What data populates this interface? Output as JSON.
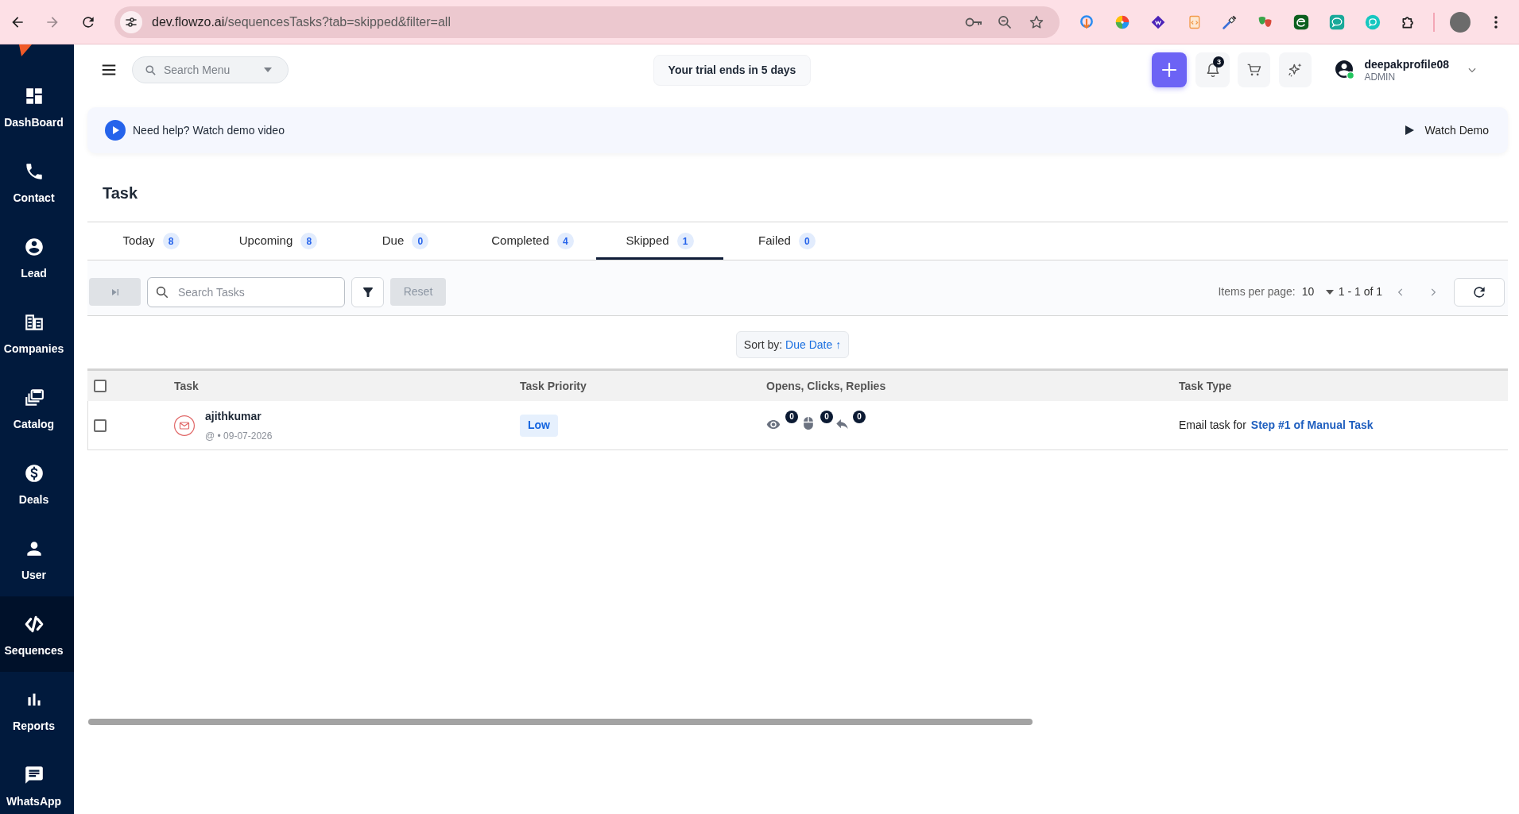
{
  "browser": {
    "url": {
      "host": "dev.flowzo.ai",
      "path": "/sequencesTasks?tab=skipped&filter=all"
    }
  },
  "sidebar": {
    "items": [
      {
        "label": "DashBoard",
        "selected": false
      },
      {
        "label": "Contact",
        "selected": false
      },
      {
        "label": "Lead",
        "selected": false
      },
      {
        "label": "Companies",
        "selected": false
      },
      {
        "label": "Catalog",
        "selected": false
      },
      {
        "label": "Deals",
        "selected": false
      },
      {
        "label": "User",
        "selected": false
      },
      {
        "label": "Sequences",
        "selected": true
      },
      {
        "label": "Reports",
        "selected": false
      },
      {
        "label": "WhatsApp",
        "selected": false
      }
    ]
  },
  "header": {
    "search_menu": {
      "placeholder": "Search Menu"
    },
    "trial_notice": "Your trial ends in 5 days",
    "notification_count": "3",
    "user": {
      "name": "deepakprofile08",
      "role": "ADMIN"
    }
  },
  "help_banner": {
    "text": "Need help? Watch demo video",
    "action": "Watch Demo"
  },
  "page_title": "Task",
  "tabs": [
    {
      "label": "Today",
      "count": "8",
      "selected": false
    },
    {
      "label": "Upcoming",
      "count": "8",
      "selected": false
    },
    {
      "label": "Due",
      "count": "0",
      "selected": false
    },
    {
      "label": "Completed",
      "count": "4",
      "selected": false
    },
    {
      "label": "Skipped",
      "count": "1",
      "selected": true
    },
    {
      "label": "Failed",
      "count": "0",
      "selected": false
    }
  ],
  "toolbar": {
    "skip": {
      "disabled": true
    },
    "search": {
      "placeholder": "Search Tasks"
    },
    "reset": {
      "label": "Reset",
      "disabled": true
    },
    "items_per_page": {
      "label": "Items per page:",
      "value": "10"
    },
    "range": "1 - 1 of 1"
  },
  "sort": {
    "label": "Sort by:",
    "field": "Due Date ↑"
  },
  "table": {
    "select_all": {
      "checked": false
    },
    "columns": [
      "Task",
      "Task Priority",
      "Opens, Clicks, Replies",
      "Task Type"
    ],
    "rows": [
      {
        "checked": false,
        "name": "ajithkumar",
        "meta": "@ • 09-07-2026",
        "priority": "Low",
        "opens": "0",
        "clicks": "0",
        "replies": "0",
        "task_type": {
          "text": "Email task for",
          "link": "Step #1 of Manual Task"
        }
      }
    ]
  }
}
